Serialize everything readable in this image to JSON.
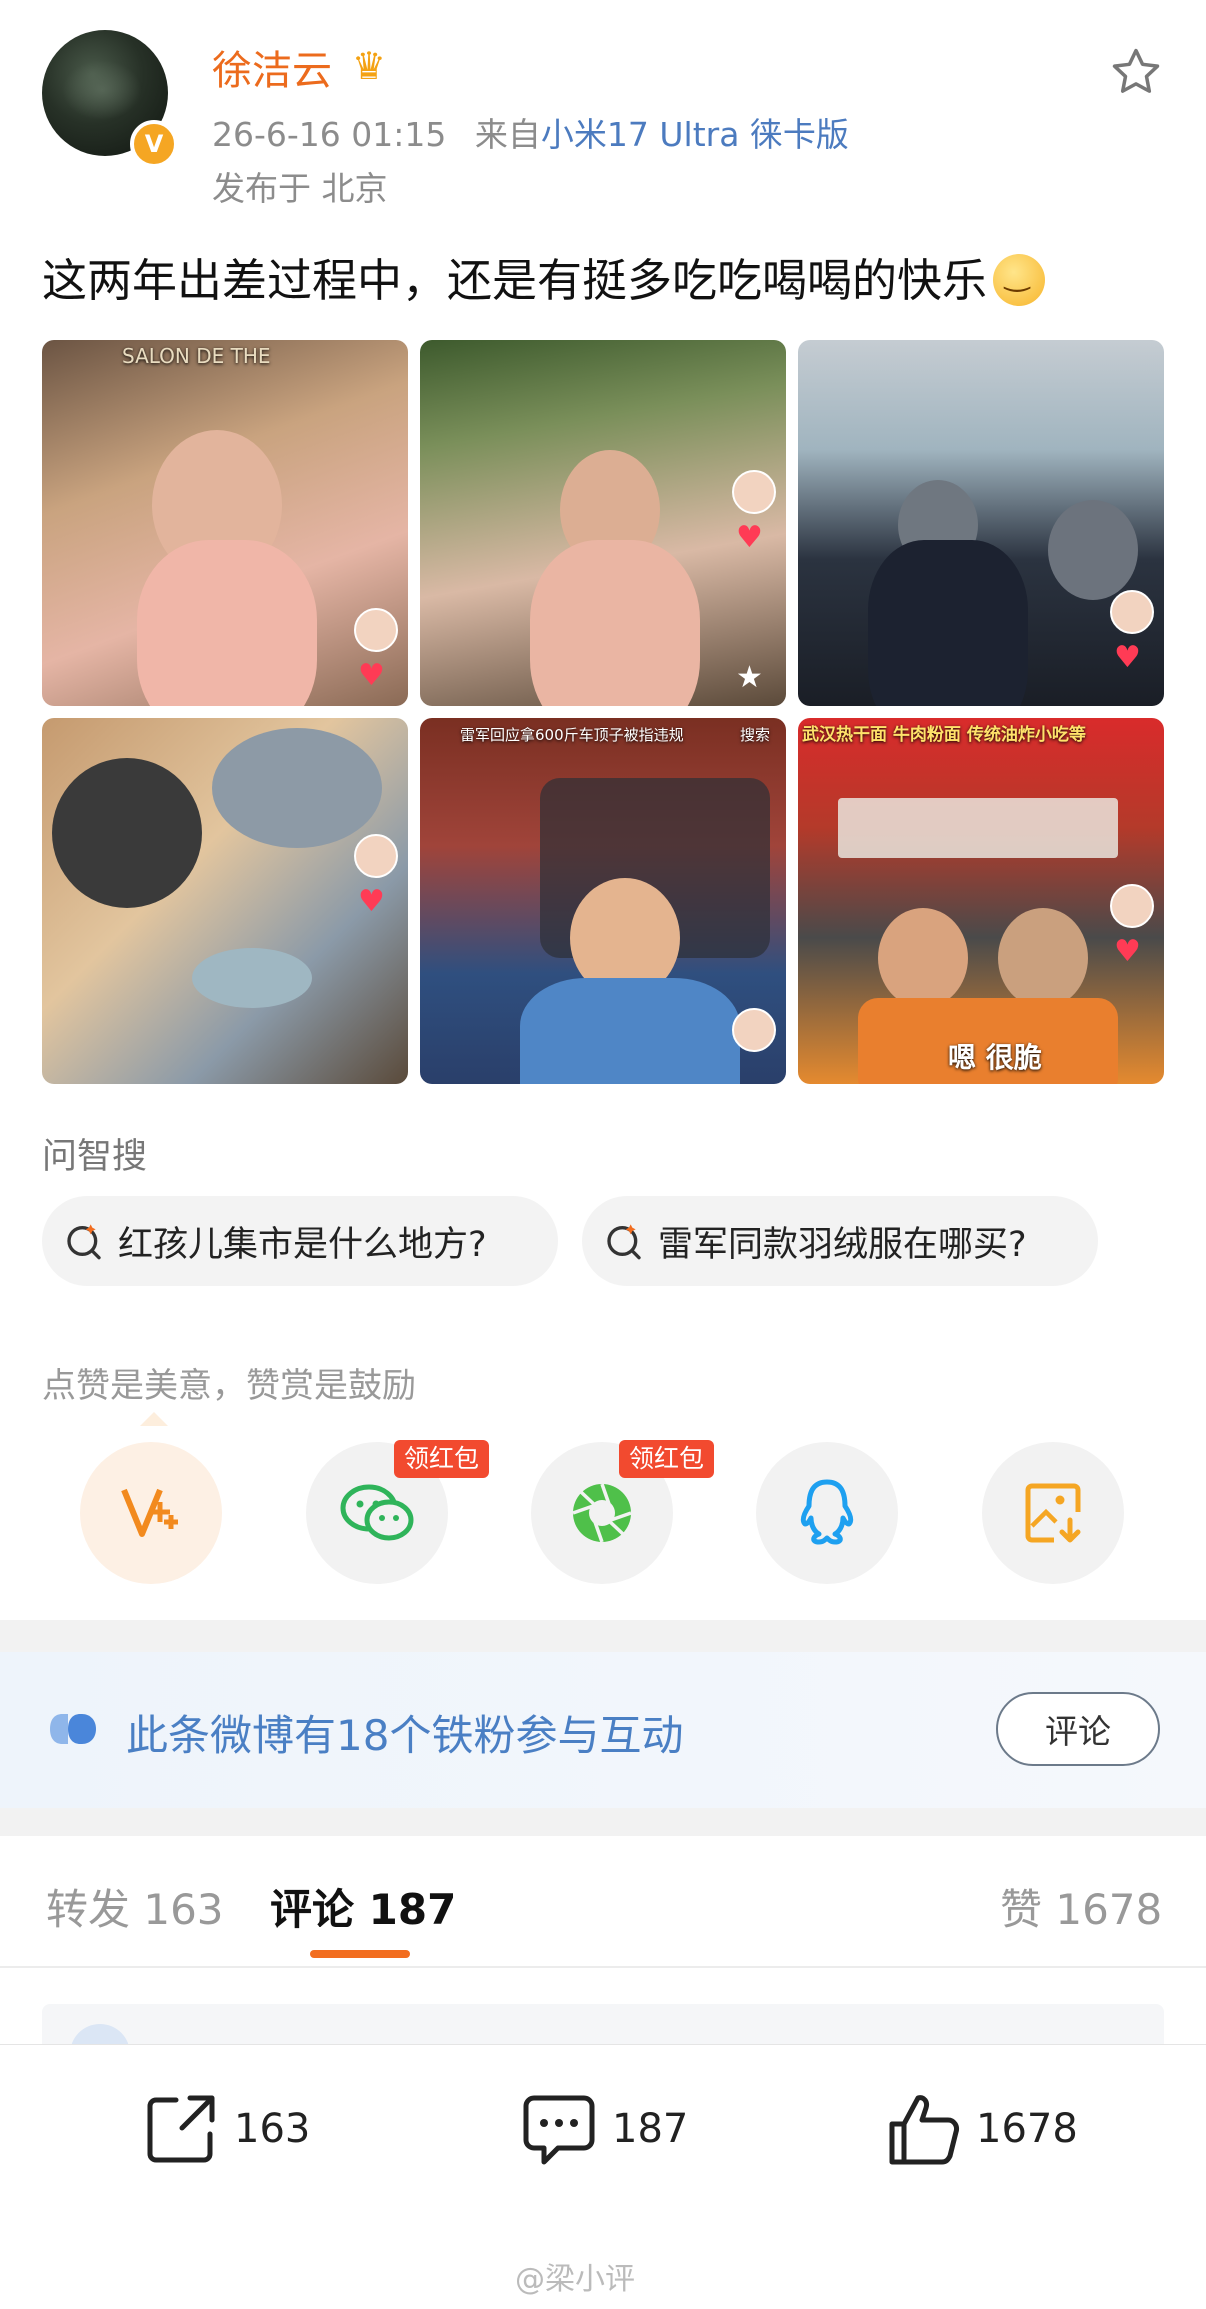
{
  "header": {
    "username": "徐洁云",
    "crown_icon": "crown-icon",
    "verified_badge": "V",
    "time": "26-6-16 01:15",
    "source_prefix": "来自",
    "source_device": "小米17 Ultra 徕卡版",
    "location": "发布于 北京"
  },
  "post": {
    "text": "这两年出差过程中，还是有挺多吃吃喝喝的快乐"
  },
  "photos": {
    "p1_text": "SALON DE THE",
    "p5_search": "雷军回应拿600斤车顶子被指违规",
    "p5_search_btn": "搜索",
    "p6_sign": "武汉热干面 牛肉粉面 传统油炸小吃等",
    "p6_caption": "嗯 很脆"
  },
  "ask": {
    "title": "问智搜",
    "chips": [
      "红孩儿集市是什么地方?",
      "雷军同款羽绒服在哪买?"
    ]
  },
  "reward": {
    "title": "点赞是美意，赞赏是鼓励",
    "badges": [
      "领红包",
      "领红包"
    ]
  },
  "fans": {
    "text": "此条微博有18个铁粉参与互动",
    "button": "评论"
  },
  "tabs": {
    "repost": "转发 163",
    "comment": "评论 187",
    "like": "赞 1678"
  },
  "bottom": {
    "repost_count": "163",
    "comment_count": "187",
    "like_count": "1678"
  },
  "watermark": "@梁小评",
  "colors": {
    "accent": "#f26d1f",
    "username": "#ec6b1d",
    "link": "#4c7bbf",
    "wechat": "#2fb45a",
    "moments": "#4fc04a",
    "qq": "#1ea0f0",
    "save": "#f5a623"
  }
}
